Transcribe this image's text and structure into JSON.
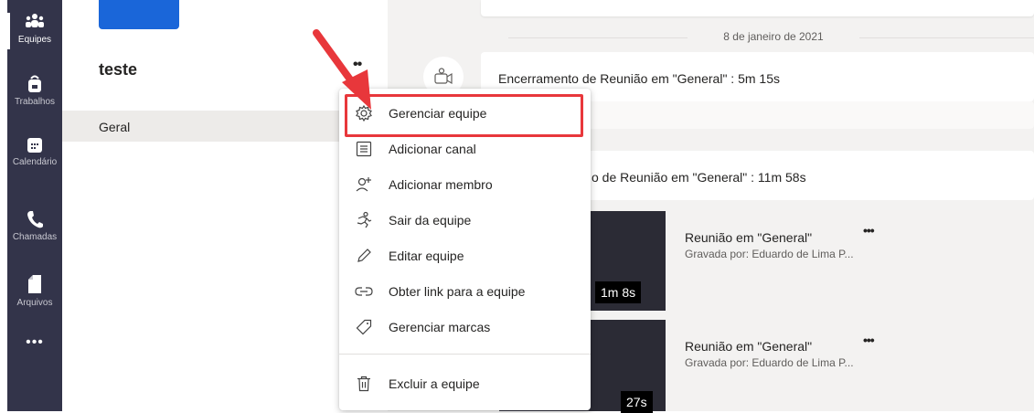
{
  "app_bar": {
    "items": [
      {
        "label": "Equipes",
        "icon": "teams-icon",
        "active": true
      },
      {
        "label": "Trabalhos",
        "icon": "assignments-icon",
        "active": false
      },
      {
        "label": "Calendário",
        "icon": "calendar-icon",
        "active": false
      },
      {
        "label": "Chamadas",
        "icon": "phone-icon",
        "active": false
      },
      {
        "label": "Arquivos",
        "icon": "file-icon",
        "active": false
      }
    ],
    "more_label": "•••"
  },
  "team": {
    "name": "teste",
    "more_label": "••",
    "channels": [
      {
        "label": "Geral"
      }
    ]
  },
  "feed": {
    "date_divider": "8 de janeiro de 2021",
    "events": [
      {
        "text": "Encerramento de Reunião em \"General\" : 5m 15s"
      },
      {
        "text": "o de Reunião em \"General\" : 11m 58s"
      }
    ],
    "recordings": [
      {
        "title": "Reunião em \"General\"",
        "subtitle": "Gravada por: Eduardo de Lima P...",
        "duration": "1m 8s",
        "more": "•••"
      },
      {
        "title": "Reunião em \"General\"",
        "subtitle": "Gravada por: Eduardo de Lima P...",
        "duration": "27s",
        "more": "•••"
      }
    ]
  },
  "context_menu": {
    "items": [
      {
        "label": "Gerenciar equipe",
        "icon": "gear-icon"
      },
      {
        "label": "Adicionar canal",
        "icon": "channel-list-icon"
      },
      {
        "label": "Adicionar membro",
        "icon": "add-member-icon"
      },
      {
        "label": "Sair da equipe",
        "icon": "leave-icon"
      },
      {
        "label": "Editar equipe",
        "icon": "pencil-icon"
      },
      {
        "label": "Obter link para a equipe",
        "icon": "link-icon"
      },
      {
        "label": "Gerenciar marcas",
        "icon": "tag-icon"
      },
      {
        "label": "Excluir a equipe",
        "icon": "trash-icon"
      }
    ]
  },
  "colors": {
    "app_bar_bg": "#33344a",
    "team_tile": "#1a66d9",
    "annotation_red": "#e8373b",
    "main_bg": "#f3f2f1"
  }
}
